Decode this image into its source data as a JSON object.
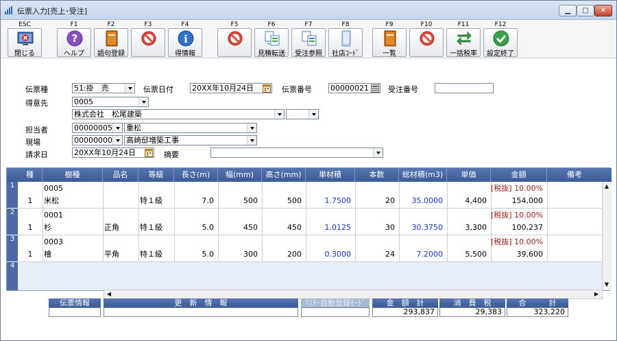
{
  "window": {
    "title": "伝票入力[売上･受注]",
    "min_glyph": "▁",
    "max_glyph": "□",
    "close_glyph": "✕"
  },
  "toolbar": {
    "buttons": [
      {
        "key": "ESC",
        "label": "閉じる",
        "icon": "close-window-icon"
      },
      {
        "key": "F1",
        "label": "ヘルプ",
        "icon": "help-icon"
      },
      {
        "key": "F2",
        "label": "語句登録",
        "icon": "book-icon"
      },
      {
        "key": "F3",
        "label": "",
        "icon": "disabled-icon"
      },
      {
        "key": "F4",
        "label": "得情報",
        "icon": "info-icon"
      },
      {
        "key": "F5",
        "label": "",
        "icon": "disabled-icon"
      },
      {
        "key": "F6",
        "label": "見積転送",
        "icon": "transfer-icon"
      },
      {
        "key": "F7",
        "label": "受注参照",
        "icon": "reference-icon"
      },
      {
        "key": "F8",
        "label": "社店ｺｰﾄﾞ",
        "icon": "code-icon"
      },
      {
        "key": "F9",
        "label": "一覧",
        "icon": "list-icon"
      },
      {
        "key": "F10",
        "label": "",
        "icon": "disabled-icon"
      },
      {
        "key": "F11",
        "label": "一括税率",
        "icon": "swap-arrows-icon"
      },
      {
        "key": "F12",
        "label": "設定終了",
        "icon": "check-icon"
      }
    ]
  },
  "form": {
    "slip_type_label": "伝票種",
    "slip_type_value": "51:掛　売",
    "slip_date_label": "伝票日付",
    "slip_date_value": "20XX年10月24日",
    "slip_no_label": "伝票番号",
    "slip_no_value": "00000021",
    "order_no_label": "受注番号",
    "order_no_value": "",
    "customer_label": "得意先",
    "customer_code": "0005",
    "customer_name": "株式会社　松尾建築",
    "customer_sub": "",
    "staff_label": "担当者",
    "staff_code": "00000005",
    "staff_name": "重松",
    "site_label": "現場",
    "site_code": "00000000",
    "site_name": "高崎邸増築工事",
    "bill_date_label": "請求日",
    "bill_date_value": "20XX年10月24日",
    "memo_label": "摘要",
    "memo_value": ""
  },
  "grid": {
    "headers": [
      "種",
      "樹種",
      "品名",
      "等級",
      "長さ(m)",
      "幅(mm)",
      "高さ(mm)",
      "単材積",
      "本数",
      "総材積(m3)",
      "単価",
      "金額",
      "備考"
    ],
    "rows": [
      {
        "no": "1",
        "kind": "1",
        "code": "0005",
        "species": "米松",
        "item": "",
        "grade": "特１級",
        "length": "7.0",
        "width": "500",
        "height": "500",
        "unit_volume": "1.7500",
        "count": "20",
        "total_volume": "35.0000",
        "price": "4,400",
        "tax": "[税抜] 10.00%",
        "amount": "154,000",
        "note": ""
      },
      {
        "no": "2",
        "kind": "1",
        "code": "0001",
        "species": "杉",
        "item": "正角",
        "grade": "特１級",
        "length": "5.0",
        "width": "450",
        "height": "450",
        "unit_volume": "1.0125",
        "count": "30",
        "total_volume": "30.3750",
        "price": "3,300",
        "tax": "[税抜] 10.00%",
        "amount": "100,237",
        "note": ""
      },
      {
        "no": "3",
        "kind": "1",
        "code": "0003",
        "species": "檜",
        "item": "平角",
        "grade": "特１級",
        "length": "5.0",
        "width": "300",
        "height": "200",
        "unit_volume": "0.3000",
        "count": "24",
        "total_volume": "7.2000",
        "price": "5,500",
        "tax": "[税抜] 10.00%",
        "amount": "39,600",
        "note": ""
      }
    ],
    "empty_row_no": "4"
  },
  "footer": {
    "slip_info_label": "伝票情報",
    "slip_info_value": "",
    "update_info_label": "更　新　情　報",
    "update_info_value": "",
    "master_auto_label": "ﾏｽﾀｰ自動登録ﾓｰﾄﾞ",
    "master_auto_value": "",
    "amount_total_label": "金　額　計",
    "amount_total_value": "293,837",
    "tax_label": "消　費　税",
    "tax_value": "29,383",
    "grand_total_label": "合　　　計",
    "grand_total_value": "323,220"
  },
  "colors": {
    "header_blue": "#3b5a97",
    "amount_blue": "#1a2fc5",
    "tax_red": "#9a1a1a"
  }
}
